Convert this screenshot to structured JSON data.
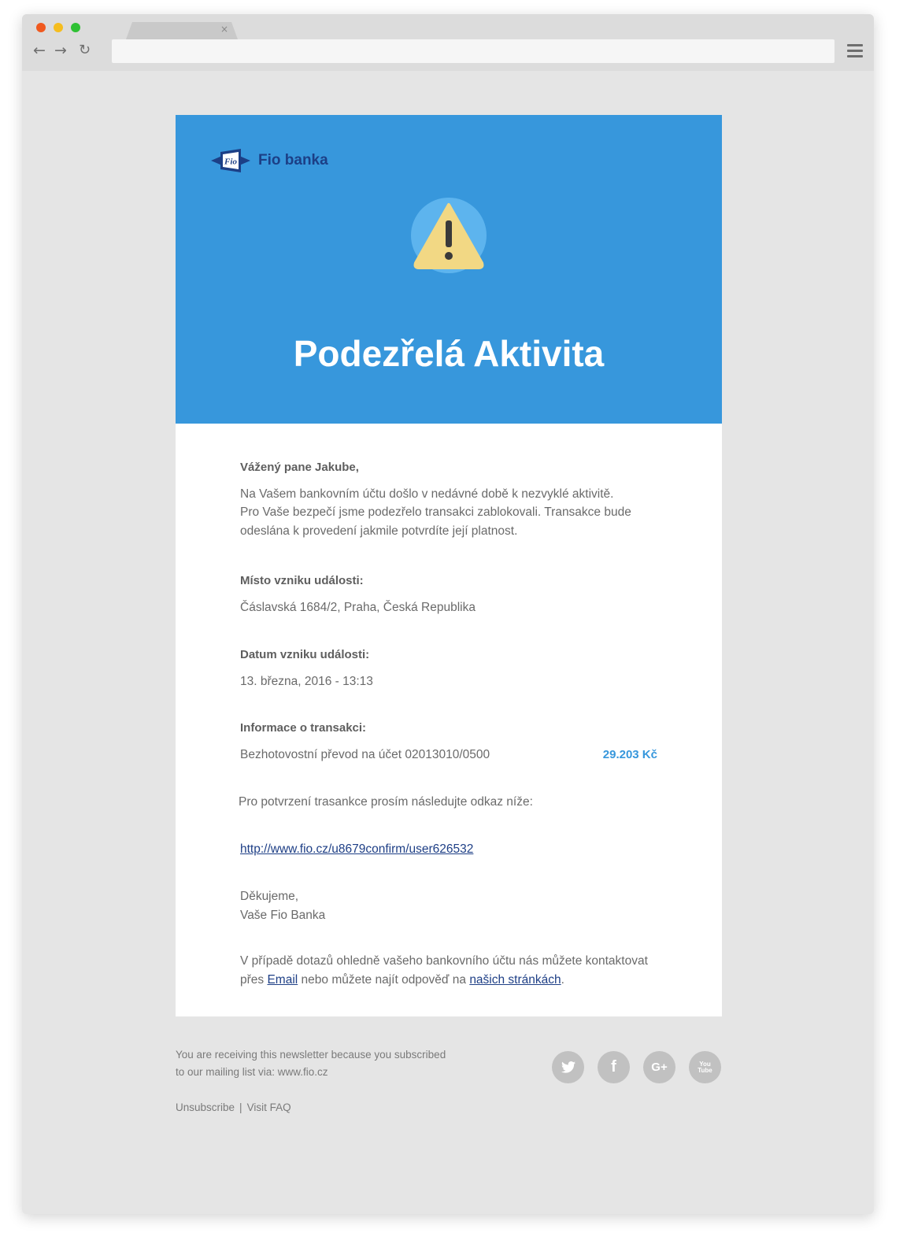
{
  "browser": {
    "tab_close": "×",
    "nav": {
      "back": "←",
      "forward": "→",
      "reload": "↻"
    }
  },
  "email": {
    "logo_text": "Fio banka",
    "logo_mark": "Fio",
    "title": "Podezřelá Aktivita",
    "greeting": "Vážený pane Jakube,",
    "intro": [
      "Na Vašem bankovním účtu došlo v nedávné době k nezvyklé aktivitě.",
      "Pro Vaše bezpečí jsme podezřelo transakci zablokovali. Transakce bude",
      "odeslána k provedení jakmile potvrdíte její platnost."
    ],
    "place_label": "Místo vzniku události:",
    "place_value": "Čáslavská 1684/2, Praha, Česká Republika",
    "date_label": "Datum vzniku události:",
    "date_value": "13. března, 2016 - 13:13",
    "tx_label": "Informace o transakci:",
    "tx_description": "Bezhotovostní převod na účet 02013010/0500",
    "tx_amount": "29.203 Kč",
    "confirm_text": "Pro potvrzení trasankce prosím následujte odkaz níže:",
    "confirm_link": "http://www.fio.cz/u8679confirm/user626532",
    "thanks_line1": "Děkujeme,",
    "thanks_line2": "Vaše Fio Banka",
    "contact_line1": "V případě dotazů ohledně vašeho bankovního účtu nás můžete kontaktovat",
    "contact_pre": "přes ",
    "contact_email": "Email",
    "contact_mid": " nebo můžete najít odpověď na ",
    "contact_site": "našich stránkách",
    "contact_end": "."
  },
  "footer": {
    "line1": "You are receiving this newsletter because you subscribed",
    "line2": "to our mailing list via: www.fio.cz",
    "unsubscribe": "Unsubscribe",
    "separator": "|",
    "faq": "Visit FAQ",
    "social": [
      {
        "icon": "twitter-icon"
      },
      {
        "icon": "facebook-icon",
        "glyph": "f"
      },
      {
        "icon": "google-plus-icon",
        "glyph": "G+"
      },
      {
        "icon": "youtube-icon",
        "glyph": "You\nTube"
      }
    ]
  },
  "colors": {
    "hero": "#3797dc",
    "warning_triangle": "#f2d884",
    "link": "#1e3f86",
    "amount": "#3797dc"
  }
}
